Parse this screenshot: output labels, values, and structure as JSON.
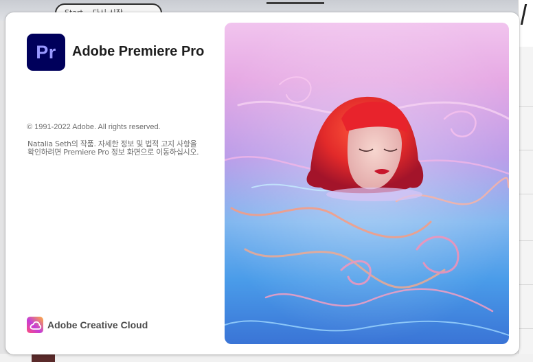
{
  "background": {
    "pill_text": "Start... 다시 시작"
  },
  "splash": {
    "logo_text": "Pr",
    "app_title": "Adobe Premiere Pro",
    "copyright": "© 1991-2022 Adobe. All rights reserved.",
    "artwork_credit": "Natalia Seth의 작품. 자세한 정보 및 법적 고지 사항을 확인하려면 Premiere Pro 정보 화면으로 이동하십시오.",
    "footer_brand": "Adobe Creative Cloud"
  },
  "colors": {
    "logo_bg": "#00005b",
    "logo_fg": "#9999ff",
    "title": "#1d1d1d",
    "body_text": "#6e6e6e"
  },
  "icons": {
    "creative_cloud": "creative-cloud-icon"
  }
}
